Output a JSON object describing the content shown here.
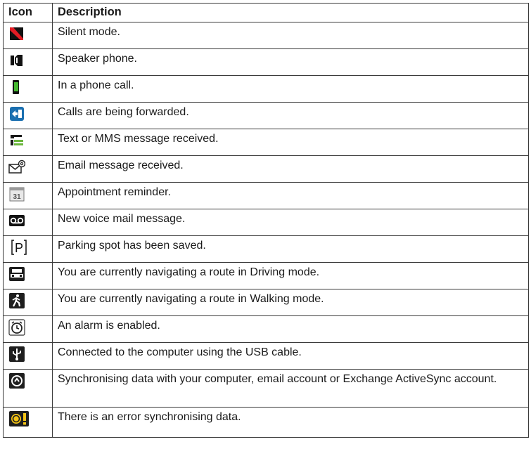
{
  "table": {
    "headers": {
      "icon": "Icon",
      "description": "Description"
    },
    "rows": [
      {
        "icon": "silent-mode-icon",
        "description": "Silent mode."
      },
      {
        "icon": "speaker-phone-icon",
        "description": "Speaker phone."
      },
      {
        "icon": "in-call-icon",
        "description": "In a phone call."
      },
      {
        "icon": "call-forwarding-icon",
        "description": "Calls are being forwarded."
      },
      {
        "icon": "text-message-icon",
        "description": "Text or MMS message received."
      },
      {
        "icon": "email-icon",
        "description": "Email message received."
      },
      {
        "icon": "calendar-icon",
        "description": "Appointment reminder.",
        "icon_text": "31"
      },
      {
        "icon": "voicemail-icon",
        "description": "New voice mail message."
      },
      {
        "icon": "parking-icon",
        "description": "Parking spot has been saved.",
        "icon_text": "P"
      },
      {
        "icon": "car-icon",
        "description": "You are currently navigating a route in Driving mode."
      },
      {
        "icon": "walking-icon",
        "description": "You are currently navigating a route in Walking mode."
      },
      {
        "icon": "alarm-icon",
        "description": "An alarm is enabled."
      },
      {
        "icon": "usb-icon",
        "description": "Connected to the computer using the USB cable."
      },
      {
        "icon": "sync-icon",
        "description": "Synchronising data with your computer, email account or Exchange ActiveSync account."
      },
      {
        "icon": "sync-error-icon",
        "description": "There is an error synchronising data."
      }
    ]
  }
}
